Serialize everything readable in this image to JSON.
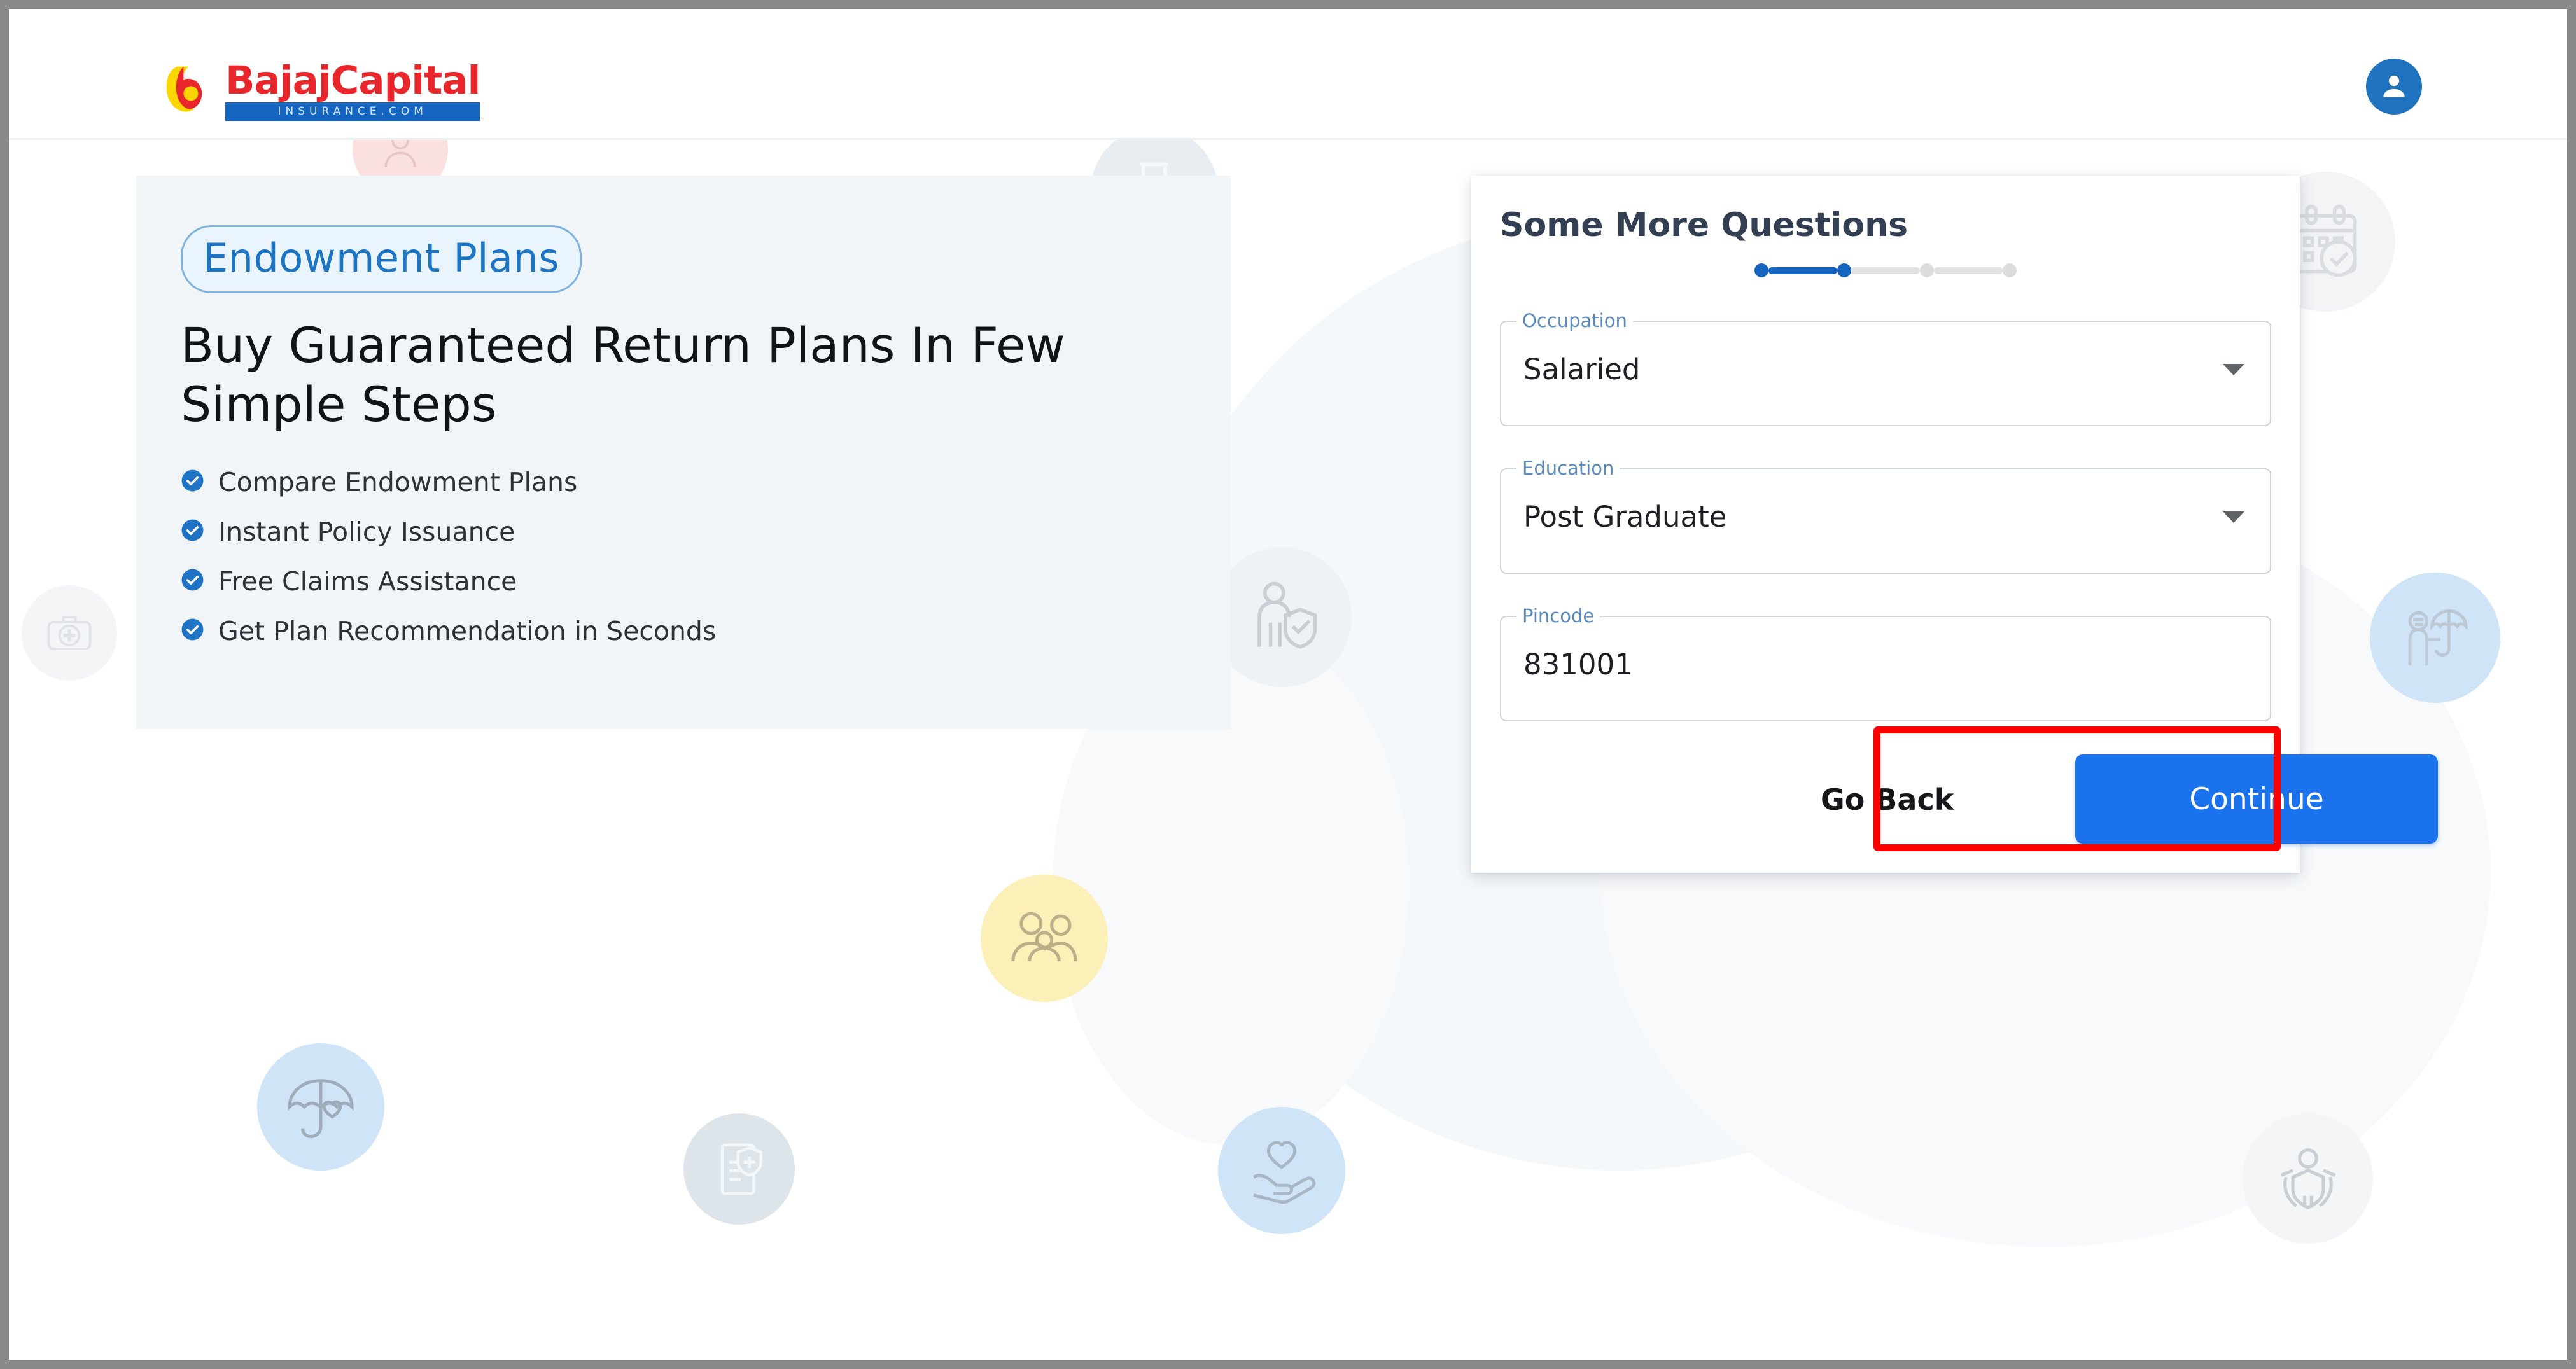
{
  "header": {
    "logo": {
      "brand_word": "BajajCapital",
      "sub_word": "INSURANCE.COM",
      "mark_icon": "bajaj-b-mark-icon",
      "brand_color": "#e8262b",
      "bar_color": "#1565c0",
      "mark_yellow": "#fbd600",
      "mark_red": "#e8262b"
    },
    "account": {
      "icon": "account-circle-icon",
      "color": "#1f72bd"
    }
  },
  "hero": {
    "badge": "Endowment Plans",
    "badge_color": "#1c74c4",
    "title": "Buy Guaranteed Return Plans In Few Simple Steps",
    "features": [
      {
        "icon": "check-circle-icon",
        "label": "Compare Endowment Plans"
      },
      {
        "icon": "check-circle-icon",
        "label": "Instant Policy Issuance"
      },
      {
        "icon": "check-circle-icon",
        "label": "Free Claims Assistance"
      },
      {
        "icon": "check-circle-icon",
        "label": "Get Plan Recommendation in Seconds"
      }
    ],
    "check_color": "#1f73c4",
    "panel_bg": "#f2f5f8"
  },
  "form": {
    "title": "Some More Questions",
    "stepper": {
      "total_steps": 4,
      "active_steps": 2,
      "active_color": "#1565c0",
      "inactive_color": "#dcdcdc"
    },
    "fields": [
      {
        "name": "occupation",
        "label": "Occupation",
        "value": "Salaried",
        "type": "select",
        "caret_icon": "chevron-down-icon"
      },
      {
        "name": "education",
        "label": "Education",
        "value": "Post Graduate",
        "type": "select",
        "caret_icon": "chevron-down-icon"
      },
      {
        "name": "pincode",
        "label": "Pincode",
        "value": "831001",
        "type": "text",
        "caret_icon": ""
      }
    ],
    "buttons": {
      "back_label": "Go Back",
      "continue_label": "Continue",
      "continue_color": "#1a73ec"
    }
  },
  "annotation": {
    "target": "continue-button",
    "color": "#fd0000"
  },
  "decorations": [
    {
      "icon": "medical-kit-icon",
      "circle_color": "#f3f5f7",
      "stroke": "#dfe3e8"
    },
    {
      "icon": "person-avatar-icon",
      "circle_color": "#fae0e0",
      "stroke": "#e8c4c4"
    },
    {
      "icon": "shield-in-hands-icon",
      "circle_color": "#f2f5f8",
      "stroke": "#e3e7eb"
    },
    {
      "icon": "hourglass-icon",
      "circle_color": "#e8edf2",
      "stroke": "#f6f8fa"
    },
    {
      "icon": "calendar-check-icon",
      "circle_color": "#f2f4f6",
      "stroke": "#d9dde1"
    },
    {
      "icon": "person-shield-icon",
      "circle_color": "#eff2f5",
      "stroke": "#c9ced4"
    },
    {
      "icon": "family-group-icon",
      "circle_color": "#fbf0b8",
      "stroke": "#b9b089"
    },
    {
      "icon": "umbrella-heart-icon",
      "circle_color": "#cfe4f7",
      "stroke": "#9fadbb"
    },
    {
      "icon": "policy-document-icon",
      "circle_color": "#dde4ea",
      "stroke": "#f4f7fa"
    },
    {
      "icon": "hand-heart-icon",
      "circle_color": "#cfe4f7",
      "stroke": "#a9b7c5"
    },
    {
      "icon": "accident-umbrella-icon",
      "circle_color": "#cfe4f7",
      "stroke": "#bcc8d4"
    },
    {
      "icon": "person-shield-body-icon",
      "circle_color": "#f3f5f7",
      "stroke": "#c9ced4"
    }
  ]
}
